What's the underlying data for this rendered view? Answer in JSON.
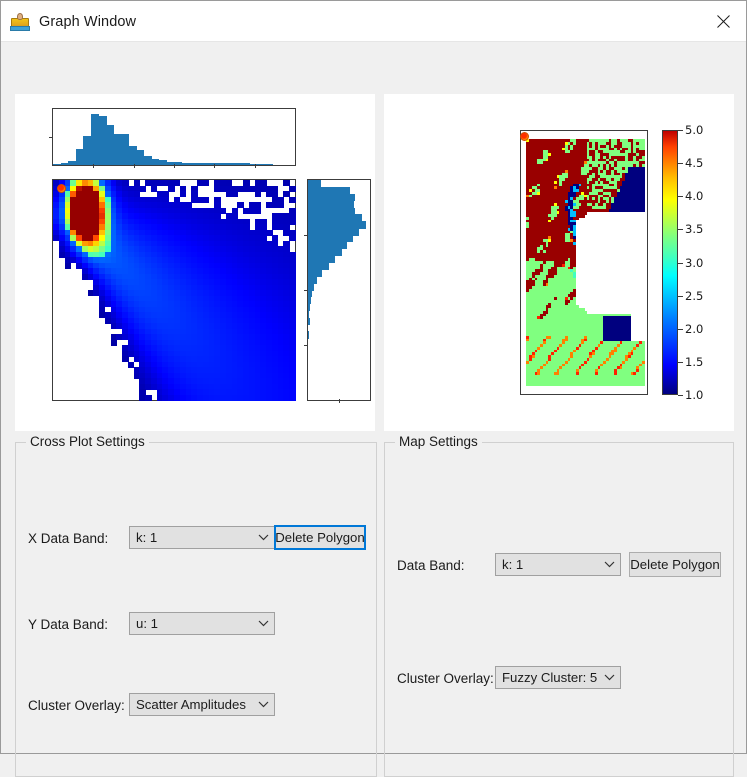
{
  "window": {
    "title": "Graph Window",
    "icon": "graph-window-icon",
    "close_icon": "close-icon"
  },
  "cross_plot_settings": {
    "title": "Cross Plot Settings",
    "x_band": {
      "label": "X Data Band:",
      "value": "k: 1"
    },
    "y_band": {
      "label": "Y Data Band:",
      "value": "u: 1"
    },
    "cluster_overlay": {
      "label": "Cluster Overlay:",
      "value": "Scatter Amplitudes"
    },
    "delete_polygon_button": "Delete Polygon",
    "delete_polygon_focused": true
  },
  "map_settings": {
    "title": "Map Settings",
    "data_band": {
      "label": "Data Band:",
      "value": "k: 1"
    },
    "cluster_overlay": {
      "label": "Cluster Overlay:",
      "value": "Fuzzy Cluster: 5"
    },
    "delete_polygon_button": "Delete Polygon",
    "delete_polygon_focused": false
  },
  "colors": {
    "accent": "#0078d7",
    "histogram_blue": "#1f77b4",
    "window_bg": "#f0f0f0",
    "card_bg": "#ffffff",
    "axis": "#3c3c3c"
  },
  "chart_data": [
    {
      "type": "bar",
      "name": "x-marginal-histogram",
      "title": "",
      "xlabel": "",
      "ylabel": "",
      "orientation": "vertical",
      "grid": false,
      "legend": null,
      "bin_centers": [
        1,
        2,
        3,
        4,
        5,
        6,
        7,
        8,
        9,
        10,
        11,
        12,
        13,
        14,
        15,
        16,
        17,
        18,
        19,
        20,
        21,
        22,
        23,
        24,
        25,
        26,
        27,
        28,
        29,
        30,
        31,
        32
      ],
      "values": [
        0.02,
        0.04,
        0.08,
        0.3,
        0.55,
        0.97,
        0.92,
        0.76,
        0.58,
        0.58,
        0.36,
        0.28,
        0.17,
        0.12,
        0.09,
        0.06,
        0.05,
        0.04,
        0.03,
        0.03,
        0.03,
        0.03,
        0.03,
        0.03,
        0.03,
        0.03,
        0.02,
        0.02,
        0.01,
        0.0,
        0.0,
        0.0
      ],
      "xtick_count": 6
    },
    {
      "type": "bar",
      "name": "y-marginal-histogram",
      "title": "",
      "xlabel": "",
      "ylabel": "",
      "orientation": "horizontal",
      "grid": false,
      "legend": null,
      "bin_centers": [
        1,
        2,
        3,
        4,
        5,
        6,
        7,
        8,
        9,
        10,
        11,
        12,
        13,
        14,
        15,
        16,
        17,
        18,
        19,
        20,
        21,
        22,
        23,
        24,
        25,
        26,
        27,
        28,
        29,
        30,
        31,
        32
      ],
      "values": [
        0.0,
        0.0,
        0.0,
        0.0,
        0.0,
        0.0,
        0.0,
        0.0,
        0.0,
        0.02,
        0.0,
        0.04,
        0.02,
        0.03,
        0.05,
        0.07,
        0.1,
        0.16,
        0.24,
        0.36,
        0.46,
        0.58,
        0.66,
        0.76,
        0.86,
        0.98,
        0.92,
        0.8,
        0.78,
        0.8,
        0.72,
        0.22
      ],
      "ytick_count": 4
    },
    {
      "type": "heatmap",
      "name": "cross-plot-density",
      "title": "",
      "xlabel": "",
      "ylabel": "",
      "colormap": "jet",
      "note": "2D density histogram of X Data Band (k: 1) vs Y Data Band (u: 1) with hot peak in upper-left quadrant",
      "marker": {
        "name": "polygon-vertex-marker",
        "x_frac": 0.035,
        "y_frac": 0.035,
        "color": "#ff2f00"
      }
    },
    {
      "type": "heatmap",
      "name": "cluster-map",
      "title": "",
      "xlabel": "",
      "ylabel": "",
      "colormap": "jet",
      "colorbar": {
        "min": 1.0,
        "max": 5.0,
        "ticks": [
          1.0,
          1.5,
          2.0,
          2.5,
          3.0,
          3.5,
          4.0,
          4.5,
          5.0
        ],
        "tick_labels": [
          "1.0",
          "1.5",
          "2.0",
          "2.5",
          "3.0",
          "3.5",
          "4.0",
          "4.5",
          "5.0"
        ]
      },
      "note": "Fuzzy Cluster: 5 overlay map, dark-red cluster upper region, light-green cluster lower region, dark-blue water bodies",
      "marker": {
        "name": "polygon-vertex-marker",
        "x_frac": 0.02,
        "y_frac": 0.02,
        "color": "#ff2f00"
      }
    }
  ]
}
